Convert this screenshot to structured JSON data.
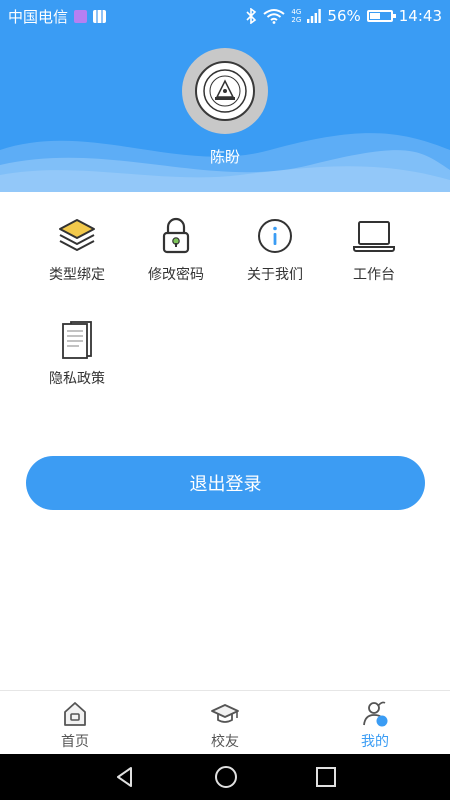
{
  "status_bar": {
    "carrier": "中国电信",
    "network": "4G 2G",
    "battery": "56%",
    "battery_level": 0.56,
    "time": "14:43"
  },
  "profile": {
    "name": "陈盼"
  },
  "menu": [
    {
      "label": "类型绑定",
      "icon": "layers-icon"
    },
    {
      "label": "修改密码",
      "icon": "lock-icon"
    },
    {
      "label": "关于我们",
      "icon": "info-icon"
    },
    {
      "label": "工作台",
      "icon": "laptop-icon"
    },
    {
      "label": "隐私政策",
      "icon": "document-icon"
    }
  ],
  "logout_label": "退出登录",
  "tabs": [
    {
      "label": "首页",
      "icon": "home-icon",
      "active": false
    },
    {
      "label": "校友",
      "icon": "graduation-cap-icon",
      "active": false
    },
    {
      "label": "我的",
      "icon": "user-icon",
      "active": true
    }
  ],
  "colors": {
    "primary": "#3a9cf4",
    "text": "#333333",
    "accent_yellow": "#f2c94c",
    "accent_green": "#7dc55a"
  }
}
